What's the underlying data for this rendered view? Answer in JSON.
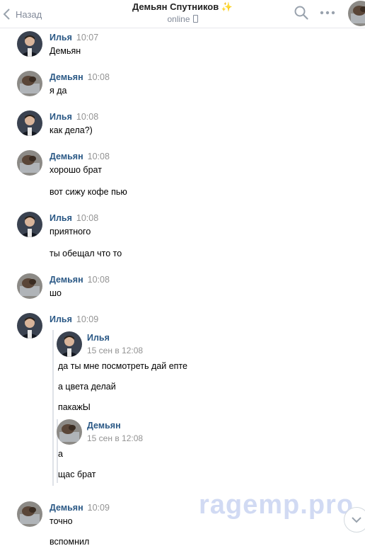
{
  "header": {
    "back_label": "Назад",
    "contact_name": "Демьян Спутников",
    "star": "✨",
    "status": "online"
  },
  "messages": [
    {
      "author": "Илья",
      "time": "10:07",
      "lines": [
        "Демьян"
      ]
    },
    {
      "author": "Демьян",
      "time": "10:08",
      "lines": [
        "я да"
      ]
    },
    {
      "author": "Илья",
      "time": "10:08",
      "lines": [
        "как дела?)"
      ]
    },
    {
      "author": "Демьян",
      "time": "10:08",
      "lines": [
        "хорошо брат",
        "вот сижу кофе пью"
      ]
    },
    {
      "author": "Илья",
      "time": "10:08",
      "lines": [
        "приятного",
        "ты обещал что то"
      ]
    },
    {
      "author": "Демьян",
      "time": "10:08",
      "lines": [
        "шо"
      ]
    },
    {
      "author": "Илья",
      "time": "10:09",
      "forwarded": [
        {
          "author": "Илья",
          "date": "15 сен в 12:08",
          "lines": [
            "да ты мне посмотреть дай епте",
            "а цвета делай",
            "пакажЫ"
          ]
        },
        {
          "author": "Демьян",
          "date": "15 сен в 12:08",
          "lines": [
            "а",
            "щас брат"
          ]
        }
      ]
    },
    {
      "author": "Демьян",
      "time": "10:09",
      "lines": [
        "точно",
        "вспомнил"
      ]
    }
  ],
  "watermark": "ragemp.pro"
}
